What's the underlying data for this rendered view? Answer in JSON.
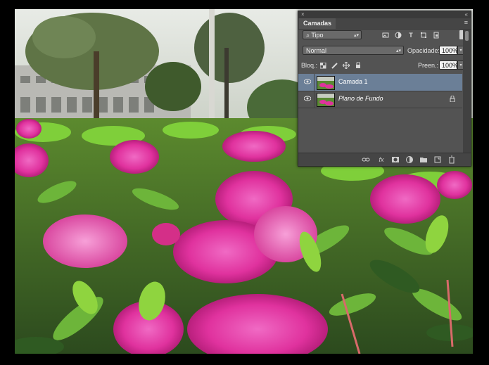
{
  "layers_panel": {
    "close_glyph": "×",
    "collapse_glyph": "«",
    "tab_label": "Camadas",
    "menu_glyph": "≡",
    "filter": {
      "value": "Tipo",
      "search_glyph": "⌕"
    },
    "filter_icons": [
      "image-filter-icon",
      "adjustment-filter-icon",
      "type-filter-icon",
      "shape-filter-icon",
      "smart-object-filter-icon"
    ],
    "blend_mode": "Normal",
    "opacity_label": "Opacidade:",
    "opacity_value": "100%",
    "lock_label": "Bloq.:",
    "lock_icons": [
      "lock-transparent-pixels-icon",
      "lock-image-pixels-icon",
      "lock-position-icon",
      "lock-all-icon"
    ],
    "fill_label": "Preen.:",
    "fill_value": "100%",
    "layers": [
      {
        "name": "Camada 1",
        "selected": true,
        "visible": true,
        "locked": false
      },
      {
        "name": "Plano de Fundo",
        "selected": false,
        "visible": true,
        "locked": true
      }
    ],
    "bottom_icons": [
      "link-layers-icon",
      "fx-icon",
      "add-mask-icon",
      "adjustment-layer-icon",
      "new-group-icon",
      "new-layer-icon",
      "delete-layer-icon"
    ],
    "fx_glyph": "fx"
  },
  "colors": {
    "panel_bg": "#535353",
    "selected_row": "#6b7f97",
    "window_bg": "#000000"
  }
}
